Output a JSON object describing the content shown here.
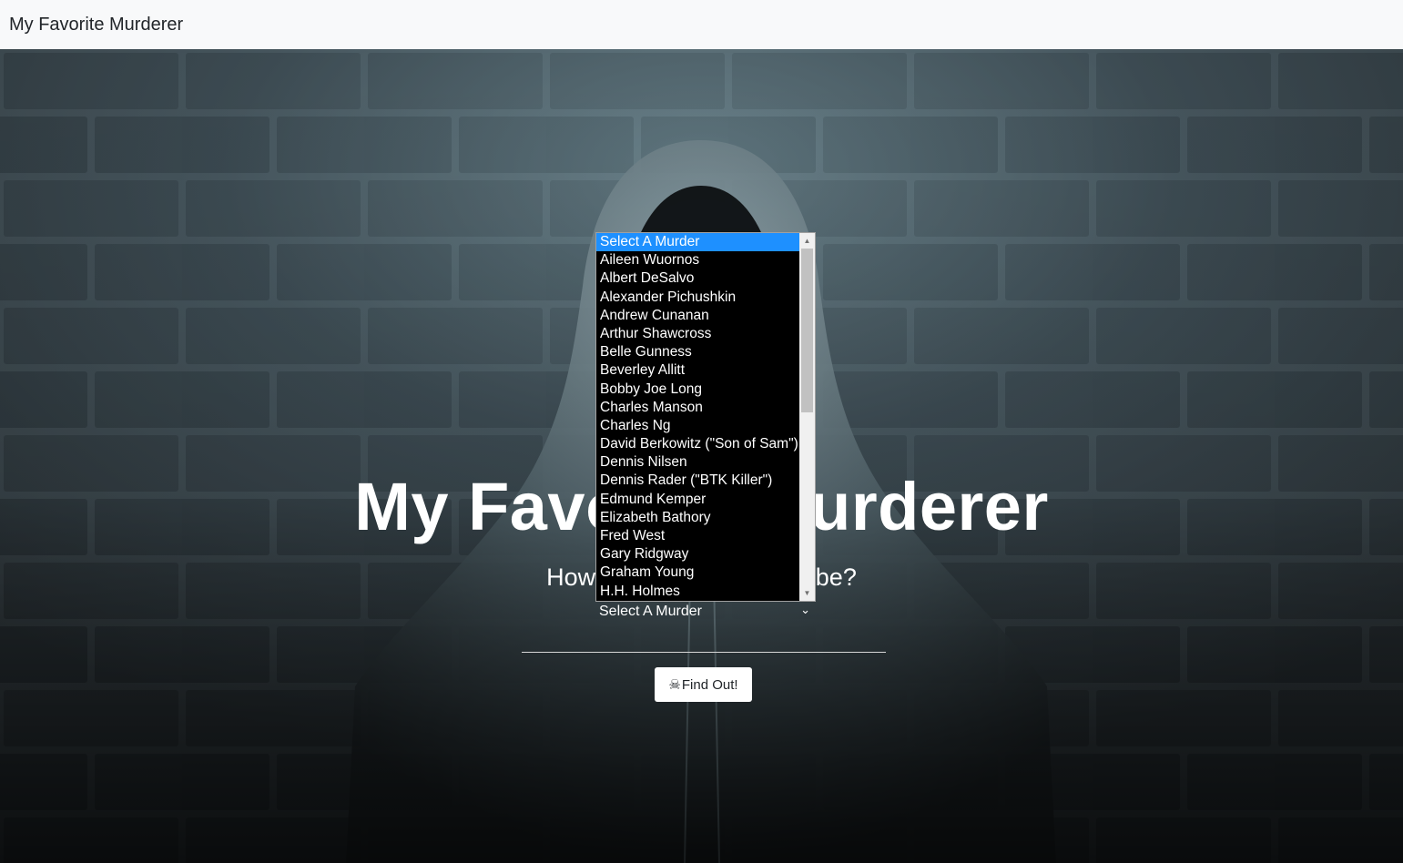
{
  "navbar": {
    "brand": "My Favorite Murderer"
  },
  "hero": {
    "title": "My Favorite Murderer",
    "subtitle": "How dark can you really be?"
  },
  "murder_select": {
    "value": "Select A Murder",
    "options": [
      "Select A Murder",
      "Aileen Wuornos",
      "Albert DeSalvo",
      "Alexander Pichushkin",
      "Andrew Cunanan",
      "Arthur Shawcross",
      "Belle Gunness",
      "Beverley Allitt",
      "Bobby Joe Long",
      "Charles Manson",
      "Charles Ng",
      "David Berkowitz (\"Son of Sam\")",
      "Dennis Nilsen",
      "Dennis Rader (\"BTK Killer\")",
      "Edmund Kemper",
      "Elizabeth Bathory",
      "Fred West",
      "Gary Ridgway",
      "Graham Young",
      "H.H. Holmes"
    ],
    "selected_index": 0
  },
  "find_button": {
    "icon": "skull-crossbones-icon",
    "label": "Find Out!"
  },
  "colors": {
    "navbar_bg": "#f8f9fa",
    "highlight": "#1e90ff",
    "dropdown_bg": "#000000"
  }
}
